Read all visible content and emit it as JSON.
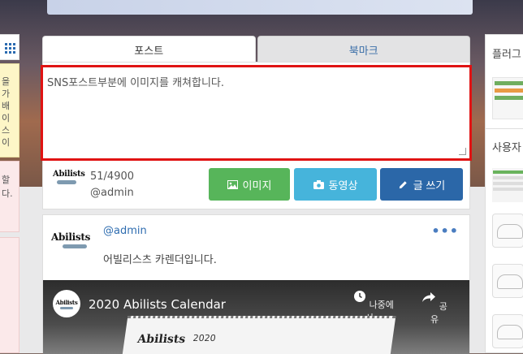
{
  "left_sidebar": {
    "notice_text": "을\n가\n배\n이\n스\n이",
    "pink_text": "할\n다."
  },
  "composer": {
    "tabs": [
      {
        "label": "포스트",
        "active": true
      },
      {
        "label": "북마크",
        "active": false
      }
    ],
    "textarea_placeholder": "SNS포스트부분에 이미지를 캐쳐합니다.",
    "char_count": "51/4900",
    "author_handle": "@admin",
    "logo_text": "Abilists",
    "buttons": {
      "image": {
        "label": "이미지",
        "icon": "image-icon",
        "color": "#57b55a"
      },
      "video": {
        "label": "동영상",
        "icon": "camera-icon",
        "color": "#46b4db"
      },
      "write": {
        "label": "글 쓰기",
        "icon": "pencil-icon",
        "color": "#2b67a8"
      }
    },
    "highlight_color": "#e01313"
  },
  "post": {
    "author": "@admin",
    "text": "어빌리스츠 카렌더입니다.",
    "more_label": "•••",
    "logo_text": "Abilists",
    "video": {
      "title": "2020 Abilists Calendar",
      "watch_later_label": "나중에 시...",
      "share_label": "공유",
      "calendar_brand": "Abilists",
      "calendar_year": "2020"
    }
  },
  "right_sidebar": {
    "box1_title": "플러그",
    "box2_title": "사용자"
  }
}
